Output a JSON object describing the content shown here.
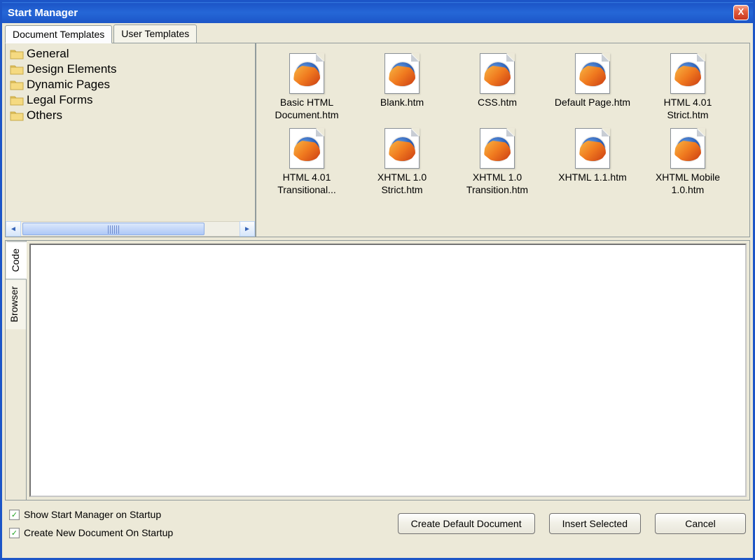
{
  "window": {
    "title": "Start Manager"
  },
  "tabs": {
    "doc": "Document Templates",
    "user": "User Templates",
    "active": "doc"
  },
  "sidebar": {
    "folders": [
      {
        "label": "General"
      },
      {
        "label": "Design Elements"
      },
      {
        "label": "Dynamic Pages"
      },
      {
        "label": "Legal Forms"
      },
      {
        "label": "Others"
      }
    ]
  },
  "templates": [
    {
      "label": "Basic HTML Document.htm"
    },
    {
      "label": "Blank.htm"
    },
    {
      "label": "CSS.htm"
    },
    {
      "label": "Default Page.htm"
    },
    {
      "label": "HTML 4.01 Strict.htm"
    },
    {
      "label": "HTML 4.01 Transitional..."
    },
    {
      "label": "XHTML 1.0 Strict.htm"
    },
    {
      "label": "XHTML 1.0 Transition.htm"
    },
    {
      "label": "XHTML 1.1.htm"
    },
    {
      "label": "XHTML Mobile 1.0.htm"
    }
  ],
  "preview_tabs": {
    "code": "Code",
    "browser": "Browser",
    "active": "code"
  },
  "bottom": {
    "check1": "Show Start Manager on Startup",
    "check2": "Create New Document On Startup",
    "check1_checked": true,
    "check2_checked": true,
    "btn_create": "Create Default Document",
    "btn_insert": "Insert Selected",
    "btn_cancel": "Cancel"
  },
  "icons": {
    "folder": "folder-icon",
    "scroll_left": "◄",
    "scroll_right": "►",
    "close": "X",
    "check": "✓"
  }
}
